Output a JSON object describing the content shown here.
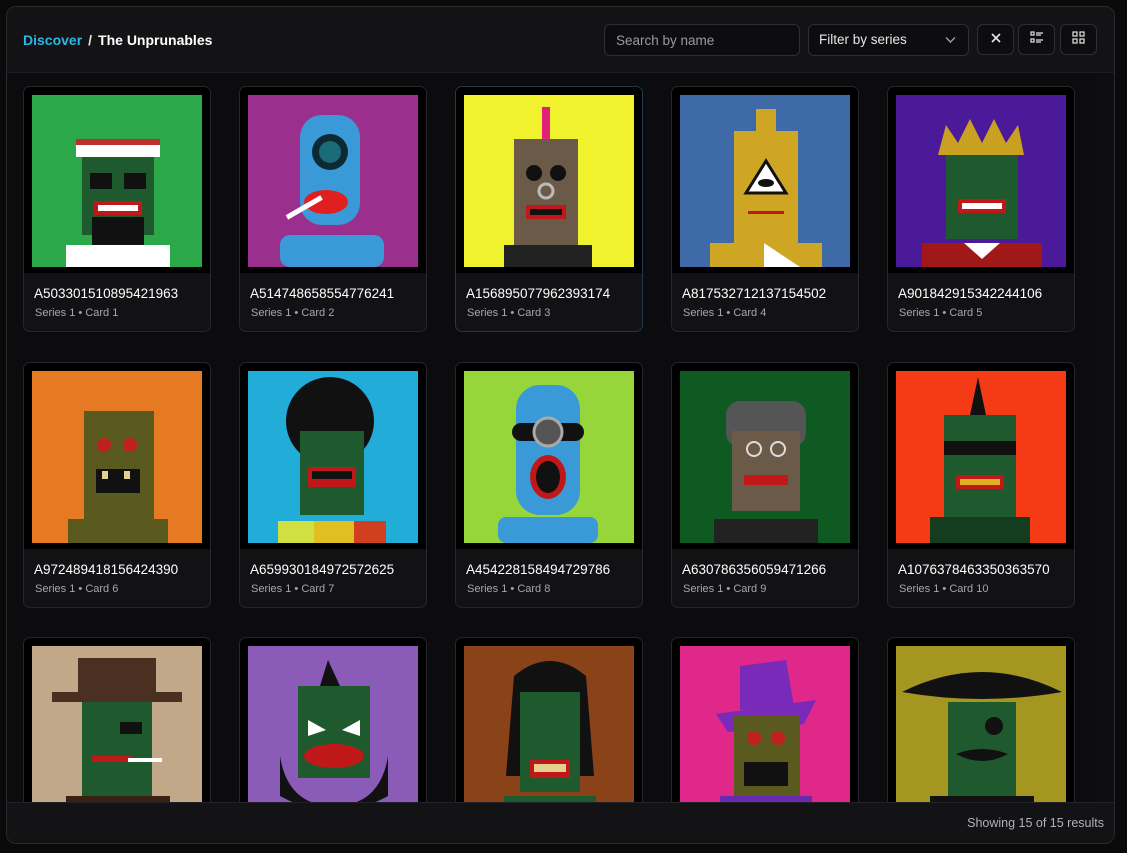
{
  "breadcrumb": {
    "root": "Discover",
    "separator": "/",
    "current": "The Unprunables"
  },
  "search": {
    "placeholder": "Search by name",
    "value": ""
  },
  "filter": {
    "label": "Filter by series",
    "icon": "chevron-down-icon"
  },
  "toolbar": {
    "clear_icon": "close-icon",
    "list_view_icon": "list-view-icon",
    "grid_view_icon": "grid-view-icon"
  },
  "cards": [
    {
      "name": "A503301510895421963",
      "meta": "Series 1 • Card 1",
      "bg": "#2aa84a"
    },
    {
      "name": "A514748658554776241",
      "meta": "Series 1 • Card 2",
      "bg": "#9a2f8e"
    },
    {
      "name": "A156895077962393174",
      "meta": "Series 1 • Card 3",
      "bg": "#f0f22e"
    },
    {
      "name": "A817532712137154502",
      "meta": "Series 1 • Card 4",
      "bg": "#3e6aa8"
    },
    {
      "name": "A901842915342244106",
      "meta": "Series 1 • Card 5",
      "bg": "#4a1a9a"
    },
    {
      "name": "A972489418156424390",
      "meta": "Series 1 • Card 6",
      "bg": "#e57a22"
    },
    {
      "name": "A659930184972572625",
      "meta": "Series 1 • Card 7",
      "bg": "#22acd8"
    },
    {
      "name": "A454228158494729786",
      "meta": "Series 1 • Card 8",
      "bg": "#96d63a"
    },
    {
      "name": "A630786356059471266",
      "meta": "Series 1 • Card 9",
      "bg": "#0f5a22"
    },
    {
      "name": "A1076378463350363570",
      "meta": "Series 1 • Card 10",
      "bg": "#f53a16"
    },
    {
      "name": "",
      "meta": "",
      "bg": "#c0a888"
    },
    {
      "name": "",
      "meta": "",
      "bg": "#8a5cb8"
    },
    {
      "name": "",
      "meta": "",
      "bg": "#8a4218"
    },
    {
      "name": "",
      "meta": "",
      "bg": "#e0288a"
    },
    {
      "name": "",
      "meta": "",
      "bg": "#a49620"
    }
  ],
  "footer": {
    "results": "Showing 15 of 15 results"
  }
}
